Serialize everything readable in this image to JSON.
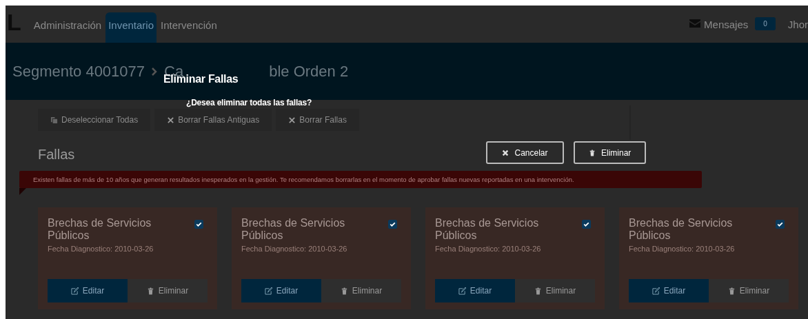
{
  "nav": {
    "logo": "L",
    "tabs": [
      {
        "label": "Administración",
        "selected": false
      },
      {
        "label": "Inventario",
        "selected": true
      },
      {
        "label": "Intervención",
        "selected": false
      }
    ],
    "messages": {
      "label": "Mensajes",
      "count": "0"
    },
    "user": "Jhor"
  },
  "breadcrumb": {
    "segment": "Segmento 4001077",
    "current_start": "Ca",
    "current_end": "ble Orden 2"
  },
  "toolbar": [
    {
      "kind": "deselect",
      "label": "Deseleccionar Todas"
    },
    {
      "kind": "clear",
      "label": "Borrar Fallas Antiguas"
    },
    {
      "kind": "clear",
      "label": "Borrar Fallas"
    }
  ],
  "section": {
    "title": "Fallas",
    "alert": "Existen fallas de más de 10 años que generan resultados inesperados en la gestión. Te recomendamos borrarlas en el momento de aprobar fallas nuevas reportadas en una intervención."
  },
  "cards": [
    {
      "title": "Brechas de Servicios Públicos",
      "checked": true,
      "date": "Fecha Diagnostico: 2010-03-26",
      "edit": "Editar",
      "delete": "Eliminar"
    },
    {
      "title": "Brechas de Servicios Públicos",
      "checked": true,
      "date": "Fecha Diagnostico: 2010-03-26",
      "edit": "Editar",
      "delete": "Eliminar"
    },
    {
      "title": "Brechas de Servicios Públicos",
      "checked": true,
      "date": "Fecha Diagnostico: 2010-03-26",
      "edit": "Editar",
      "delete": "Eliminar"
    },
    {
      "title": "Brechas de Servicios Públicos",
      "checked": true,
      "date": "Fecha Diagnostico: 2010-03-26",
      "edit": "Editar",
      "delete": "Eliminar"
    }
  ],
  "modal": {
    "title": "Eliminar Fallas",
    "message": "¿Desea eliminar todas las fallas?",
    "buttons": [
      {
        "kind": "cancel",
        "label": "Cancelar"
      },
      {
        "kind": "delete",
        "label": "Eliminar"
      }
    ]
  }
}
